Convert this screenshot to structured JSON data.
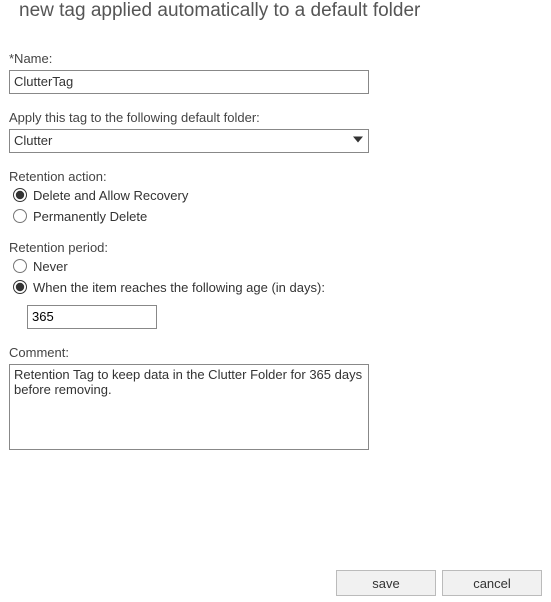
{
  "title": "new tag applied automatically to a default folder",
  "name_field": {
    "label": "*Name:",
    "value": "ClutterTag"
  },
  "folder_field": {
    "label": "Apply this tag to the following default folder:",
    "value": "Clutter"
  },
  "retention_action": {
    "label": "Retention action:",
    "options": {
      "delete_recover": "Delete and Allow Recovery",
      "perm_delete": "Permanently Delete"
    }
  },
  "retention_period": {
    "label": "Retention period:",
    "options": {
      "never": "Never",
      "age": "When the item reaches the following age (in days):"
    },
    "value": "365"
  },
  "comment_field": {
    "label": "Comment:",
    "value": "Retention Tag to keep data in the Clutter Folder for 365 days before removing."
  },
  "buttons": {
    "save": "save",
    "cancel": "cancel"
  }
}
